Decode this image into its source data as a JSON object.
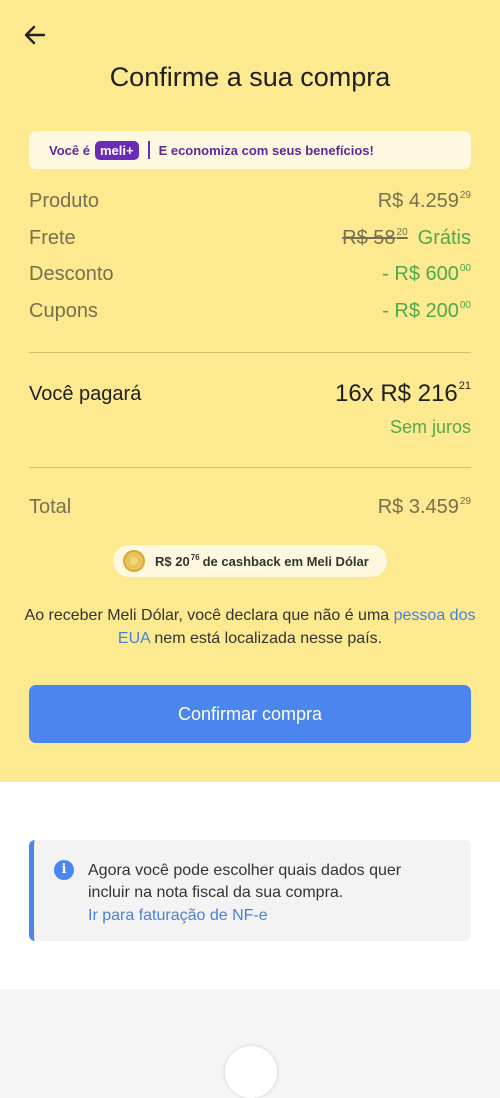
{
  "header": {
    "back_icon": "arrow-left-icon",
    "title": "Confirme a sua compra"
  },
  "meli_banner": {
    "prefix": "Você é",
    "badge": "meli+",
    "text": "E economiza com seus benefícios!"
  },
  "summary": {
    "produto": {
      "label": "Produto",
      "main": "R$ 4.259",
      "cents": "29"
    },
    "frete": {
      "label": "Frete",
      "old_main": "R$ 58",
      "old_cents": "20",
      "value": "Grátis"
    },
    "desconto": {
      "label": "Desconto",
      "main": "- R$ 600",
      "cents": "00"
    },
    "cupons": {
      "label": "Cupons",
      "main": "- R$ 200",
      "cents": "00"
    }
  },
  "payment": {
    "label": "Você pagará",
    "installments": "16x R$ 216",
    "cents": "21",
    "note": "Sem juros"
  },
  "total": {
    "label": "Total",
    "main": "R$ 3.459",
    "cents": "29"
  },
  "cashback": {
    "amount_main": "R$ 20",
    "amount_cents": "76",
    "text": "de cashback em Meli Dólar"
  },
  "disclaimer": {
    "text1": "Ao receber Meli Dólar, você declara que não é uma",
    "link": "pessoa dos EUA",
    "text2": "nem está localizada nesse país."
  },
  "confirm_button": "Confirmar compra",
  "info_card": {
    "text": "Agora você pode escolher quais dados quer incluir na nota fiscal da sua compra.",
    "link": "Ir para faturação de NF-e"
  },
  "colors": {
    "background_yellow": "#fde98f",
    "primary_blue": "#4a86ee",
    "green": "#4fa94f",
    "meli_purple": "#6a2bb8"
  }
}
